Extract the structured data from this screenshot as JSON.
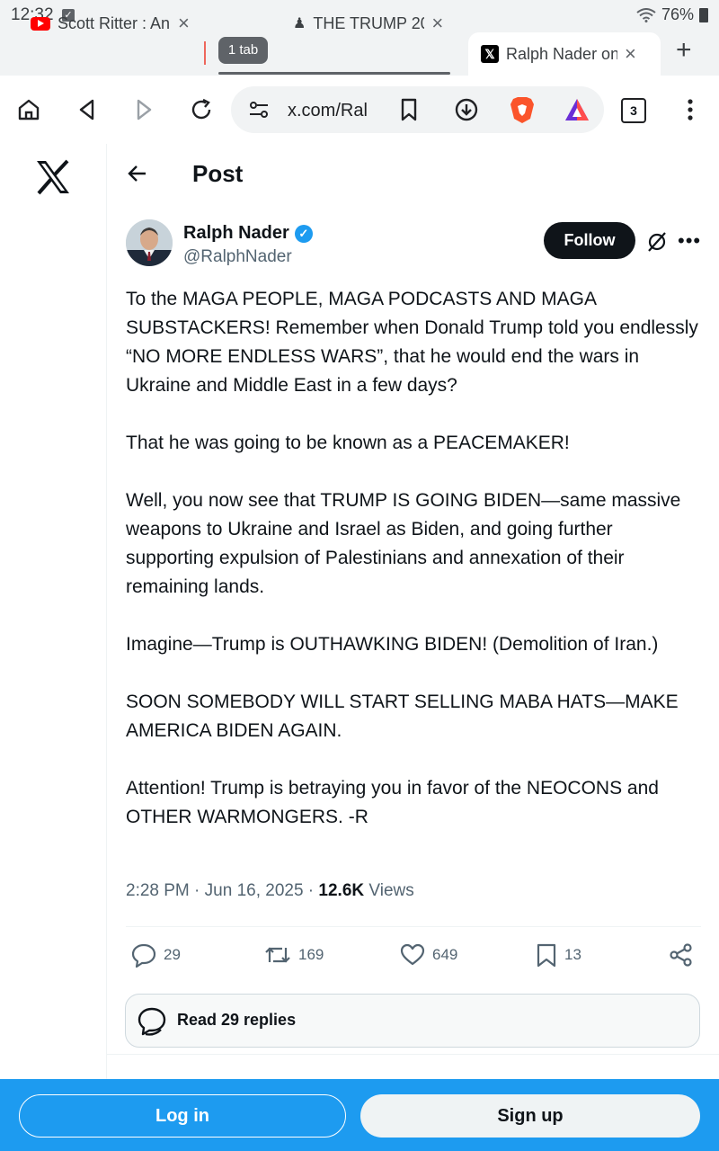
{
  "status_bar": {
    "time": "12:32",
    "battery": "76%"
  },
  "tabs": [
    {
      "title": "Scott Ritter : An",
      "active": false
    },
    {
      "title": "THE TRUMP 20",
      "active": false
    },
    {
      "title": "Ralph Nader on",
      "active": true
    }
  ],
  "tab_group": {
    "label": "1 tab"
  },
  "toolbar": {
    "url": "x.com/Ral",
    "tab_count": "3"
  },
  "header": {
    "title": "Post"
  },
  "author": {
    "name": "Ralph Nader",
    "handle": "@RalphNader",
    "follow_label": "Follow"
  },
  "tweet": {
    "paragraphs": [
      "To the MAGA PEOPLE, MAGA PODCASTS AND MAGA SUBSTACKERS! Remember when Donald Trump told you endlessly “NO MORE ENDLESS WARS”, that he would end the wars in Ukraine and Middle East in a few days?",
      "That he was going to be known as a PEACEMAKER!",
      "Well, you now see that TRUMP IS GOING BIDEN—same massive weapons to Ukraine and Israel as Biden, and going further supporting expulsion of Palestinians and annexation of their remaining lands.",
      "Imagine—Trump is OUTHAWKING BIDEN! (Demolition of Iran.)",
      "SOON SOMEBODY WILL START SELLING MABA HATS—MAKE AMERICA BIDEN AGAIN.",
      "Attention! Trump is betraying you in favor of the NEOCONS and OTHER WARMONGERS. -R"
    ],
    "time": "2:28 PM",
    "date": "Jun 16, 2025",
    "views_count": "12.6K",
    "views_label": "Views"
  },
  "stats": {
    "replies": "29",
    "reposts": "169",
    "likes": "649",
    "bookmarks": "13"
  },
  "read_replies": "Read 29 replies",
  "bottom_bar": {
    "login": "Log in",
    "signup": "Sign up"
  },
  "colors": {
    "accent": "#1d9bf0",
    "text": "#0f1419",
    "muted": "#536471"
  }
}
